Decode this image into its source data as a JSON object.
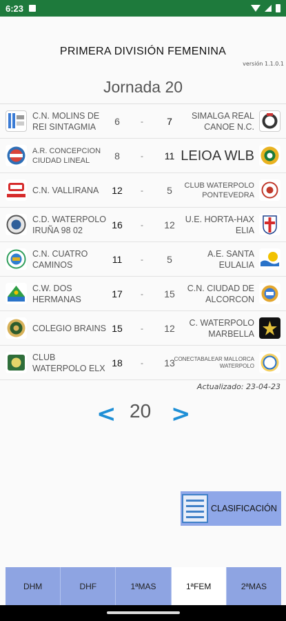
{
  "status": {
    "time": "6:23"
  },
  "header": {
    "title": "PRIMERA DIVISIÓN FEMENINA",
    "version": "versión 1.1.0.1",
    "jornada": "Jornada 20"
  },
  "matches": [
    {
      "home": "C.N. MOLINS DE REI SINTAGMIA",
      "home_score": "6",
      "away_score": "7",
      "away": "SIMALGA REAL CANOE N.C."
    },
    {
      "home": "A.R. CONCEPCION CIUDAD LINEAL",
      "home_score": "8",
      "away_score": "11",
      "away": "LEIOA WLB"
    },
    {
      "home": "C.N. VALLIRANA",
      "home_score": "12",
      "away_score": "5",
      "away": "CLUB WATERPOLO PONTEVEDRA"
    },
    {
      "home": "C.D. WATERPOLO IRUÑA 98 02",
      "home_score": "16",
      "away_score": "12",
      "away": "U.E. HORTA-HAX ELIA"
    },
    {
      "home": "C.N. CUATRO CAMINOS",
      "home_score": "11",
      "away_score": "5",
      "away": "A.E. SANTA EULALIA"
    },
    {
      "home": "C.W. DOS HERMANAS",
      "home_score": "17",
      "away_score": "15",
      "away": "C.N. CIUDAD DE ALCORCON"
    },
    {
      "home": "COLEGIO BRAINS",
      "home_score": "15",
      "away_score": "12",
      "away": "C. WATERPOLO MARBELLA"
    },
    {
      "home": "CLUB WATERPOLO ELX",
      "home_score": "18",
      "away_score": "13",
      "away": "CONECTABALEAR MALLORCA WATERPOLO"
    }
  ],
  "dash": "-",
  "updated": "Actualizado: 23-04-23",
  "nav": {
    "prev": "<",
    "page": "20",
    "next": ">"
  },
  "clasificacion": "CLASIFICACIÓN",
  "tabs": [
    {
      "label": "DHM",
      "active": false
    },
    {
      "label": "DHF",
      "active": false
    },
    {
      "label": "1ªMAS",
      "active": false
    },
    {
      "label": "1ªFEM",
      "active": true
    },
    {
      "label": "2ªMAS",
      "active": false
    }
  ],
  "colors": {
    "status_bar": "#1e7a3c",
    "accent_arrow": "#1e8fd6",
    "tab_bg": "#8ea4e2",
    "tab_active": "#ffffff"
  },
  "icons": [
    "club-crest-icon",
    "list-icon",
    "wifi-icon",
    "signal-icon",
    "battery-icon"
  ]
}
